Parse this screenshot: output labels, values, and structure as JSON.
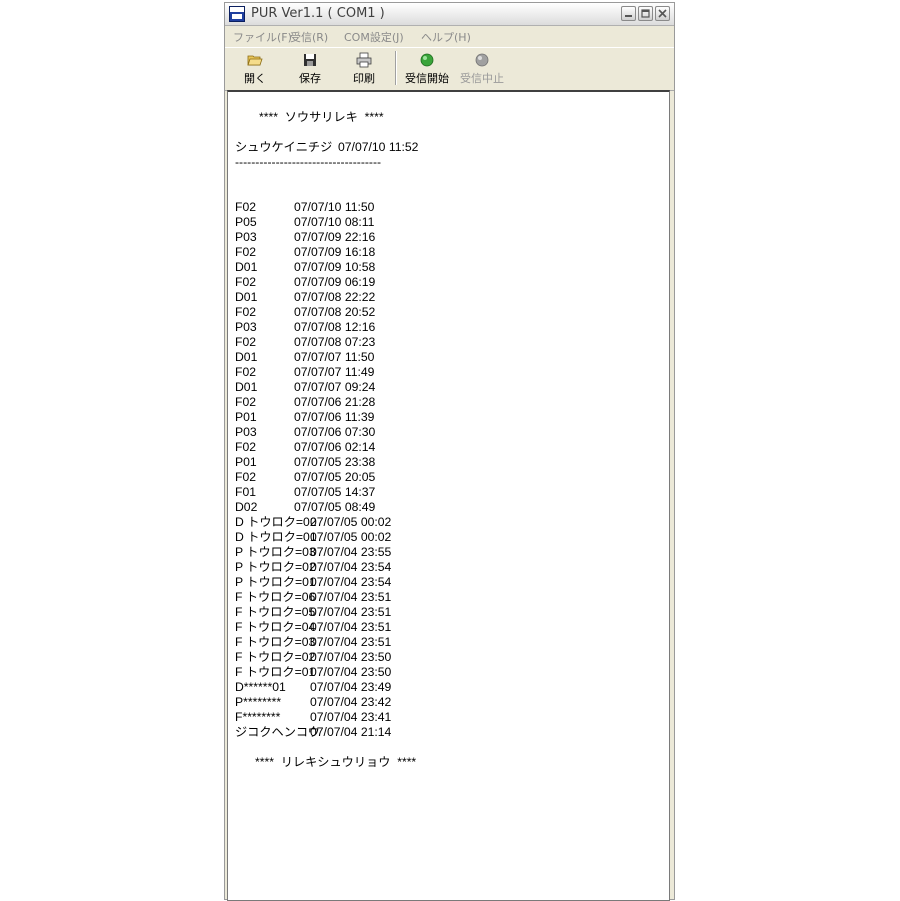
{
  "window": {
    "title": "PUR Ver1.1 ( COM1 )",
    "icon_label": "EIRO"
  },
  "menu": [
    {
      "label": "ファイル(F)"
    },
    {
      "label": "受信(R)"
    },
    {
      "label": "COM設定(J)"
    },
    {
      "label": "ヘルプ(H)"
    }
  ],
  "toolbar": {
    "open_label": "開く",
    "save_label": "保存",
    "print_label": "印刷",
    "start_label": "受信開始",
    "stop_label": "受信中止",
    "start_color": "#3aa43a",
    "stop_color": "#a0a0a0"
  },
  "log": {
    "header": "****  ソウサリレキ  ****",
    "timestamp_label": "シュウケイニチジ",
    "timestamp_value": "07/07/10 11:52",
    "separator": "------------------------------------",
    "entries": [
      {
        "id": "F02",
        "date": "07/07/10 11:50"
      },
      {
        "id": "P05",
        "date": "07/07/10 08:11"
      },
      {
        "id": "P03",
        "date": "07/07/09 22:16"
      },
      {
        "id": "F02",
        "date": "07/07/09 16:18"
      },
      {
        "id": "D01",
        "date": "07/07/09 10:58"
      },
      {
        "id": "F02",
        "date": "07/07/09 06:19"
      },
      {
        "id": "D01",
        "date": "07/07/08 22:22"
      },
      {
        "id": "F02",
        "date": "07/07/08 20:52"
      },
      {
        "id": "P03",
        "date": "07/07/08 12:16"
      },
      {
        "id": "F02",
        "date": "07/07/08 07:23"
      },
      {
        "id": "D01",
        "date": "07/07/07 11:50"
      },
      {
        "id": "F02",
        "date": "07/07/07 11:49"
      },
      {
        "id": "D01",
        "date": "07/07/07 09:24"
      },
      {
        "id": "F02",
        "date": "07/07/06 21:28"
      },
      {
        "id": "P01",
        "date": "07/07/06 11:39"
      },
      {
        "id": "P03",
        "date": "07/07/06 07:30"
      },
      {
        "id": "F02",
        "date": "07/07/06 02:14"
      },
      {
        "id": "P01",
        "date": "07/07/05 23:38"
      },
      {
        "id": "F02",
        "date": "07/07/05 20:05"
      },
      {
        "id": "F01",
        "date": "07/07/05 14:37"
      },
      {
        "id": "D02",
        "date": "07/07/05 08:49"
      },
      {
        "id": "D トウロク=02",
        "date": "07/07/05 00:02"
      },
      {
        "id": "D トウロク=01",
        "date": "07/07/05 00:02"
      },
      {
        "id": "P トウロク=03",
        "date": "07/07/04 23:55"
      },
      {
        "id": "P トウロク=02",
        "date": "07/07/04 23:54"
      },
      {
        "id": "P トウロク=01",
        "date": "07/07/04 23:54"
      },
      {
        "id": "F トウロク=06",
        "date": "07/07/04 23:51"
      },
      {
        "id": "F トウロク=05",
        "date": "07/07/04 23:51"
      },
      {
        "id": "F トウロク=04",
        "date": "07/07/04 23:51"
      },
      {
        "id": "F トウロク=03",
        "date": "07/07/04 23:51"
      },
      {
        "id": "F トウロク=02",
        "date": "07/07/04 23:50"
      },
      {
        "id": "F トウロク=01",
        "date": "07/07/04 23:50"
      },
      {
        "id": "D******01",
        "date": "07/07/04 23:49"
      },
      {
        "id": "P********",
        "date": "07/07/04 23:42"
      },
      {
        "id": "F********",
        "date": "07/07/04 23:41"
      },
      {
        "id": "ジコクヘンコウ",
        "date": "07/07/04 21:14"
      }
    ],
    "footer": "****  リレキシュウリョウ  ****"
  }
}
